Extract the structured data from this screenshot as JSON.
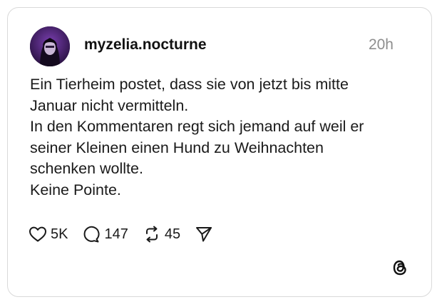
{
  "post": {
    "username": "myzelia.nocturne",
    "time": "20h",
    "lines": [
      "Ein Tierheim postet, dass sie von jetzt bis mitte",
      "Januar nicht vermitteln.",
      "In den Kommentaren regt sich jemand auf weil er",
      "seiner Kleinen einen Hund zu Weihnachten",
      "schenken wollte.",
      "Keine Pointe."
    ]
  },
  "actions": {
    "likes": "5K",
    "comments": "147",
    "reposts": "45"
  },
  "icons": {
    "like": "heart-icon",
    "comment": "comment-bubble-icon",
    "repost": "repost-icon",
    "share": "send-icon",
    "brand": "threads-logo-icon"
  }
}
